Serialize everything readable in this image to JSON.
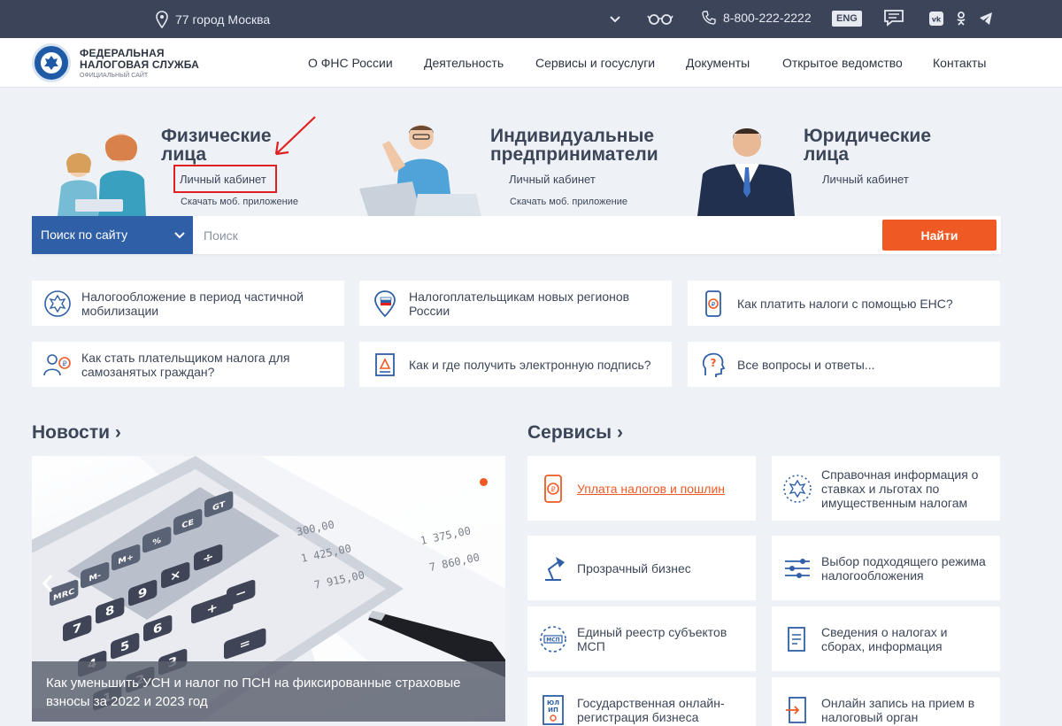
{
  "topbar": {
    "location": "77 город Москва",
    "phone": "8-800-222-2222",
    "lang": "ENG"
  },
  "header": {
    "logo_line1": "ФЕДЕРАЛЬНАЯ",
    "logo_line2": "НАЛОГОВАЯ СЛУЖБА",
    "logo_line3": "ОФИЦИАЛЬНЫЙ САЙТ",
    "nav": [
      "О ФНС России",
      "Деятельность",
      "Сервисы и госуслуги",
      "Документы",
      "Открытое ведомство",
      "Контакты"
    ]
  },
  "hero": [
    {
      "title1": "Физические",
      "title2": "лица",
      "link": "Личный кабинет",
      "sub": "Скачать моб. приложение"
    },
    {
      "title1": "Индивидуальные",
      "title2": "предприниматели",
      "link": "Личный кабинет",
      "sub": "Скачать моб. приложение"
    },
    {
      "title1": "Юридические",
      "title2": "лица",
      "link": "Личный кабинет"
    }
  ],
  "search": {
    "scope": "Поиск по сайту",
    "placeholder": "Поиск",
    "button": "Найти"
  },
  "quick": [
    "Налогообложение в период частичной мобилизации",
    "Налогоплательщикам новых регионов России",
    "Как платить налоги с помощью ЕНС?",
    "Как стать плательщиком налога для самозанятых граждан?",
    "Как и где получить электронную подпись?",
    "Все вопросы и ответы..."
  ],
  "news": {
    "title": "Новости",
    "caption": "Как уменьшить УСН и налог по ПСН на фиксированные страховые взносы за 2022 и 2023 год",
    "calc_keys": [
      "MRC",
      "M-",
      "M+",
      "%",
      "CE",
      "GT",
      "7",
      "8",
      "9",
      "4",
      "5",
      "6",
      "1",
      "2",
      "3",
      "×",
      "÷",
      "+",
      "−",
      "="
    ],
    "paper_numbers": [
      "300,00",
      "1 425,00",
      "7 915,00",
      "1 375,00",
      "7 860,00"
    ]
  },
  "services": {
    "title": "Сервисы",
    "items": [
      {
        "label": "Уплата налогов и пошлин",
        "link": true
      },
      {
        "label": "Справочная информация о ставках и льготах по имущественным налогам"
      },
      {
        "label": "Прозрачный бизнес"
      },
      {
        "label": "Выбор подходящего режима налогообложения"
      },
      {
        "label": "Единый реестр субъектов МСП"
      },
      {
        "label": "Сведения о налогах и сборах, информация"
      },
      {
        "label": "Государственная онлайн-регистрация бизнеса"
      },
      {
        "label": "Онлайн запись на прием в налоговый орган"
      }
    ]
  },
  "colors": {
    "topbar": "#3b4459",
    "accent": "#ef5a24",
    "primary": "#2f5fa6",
    "annotation": "#e02020"
  }
}
